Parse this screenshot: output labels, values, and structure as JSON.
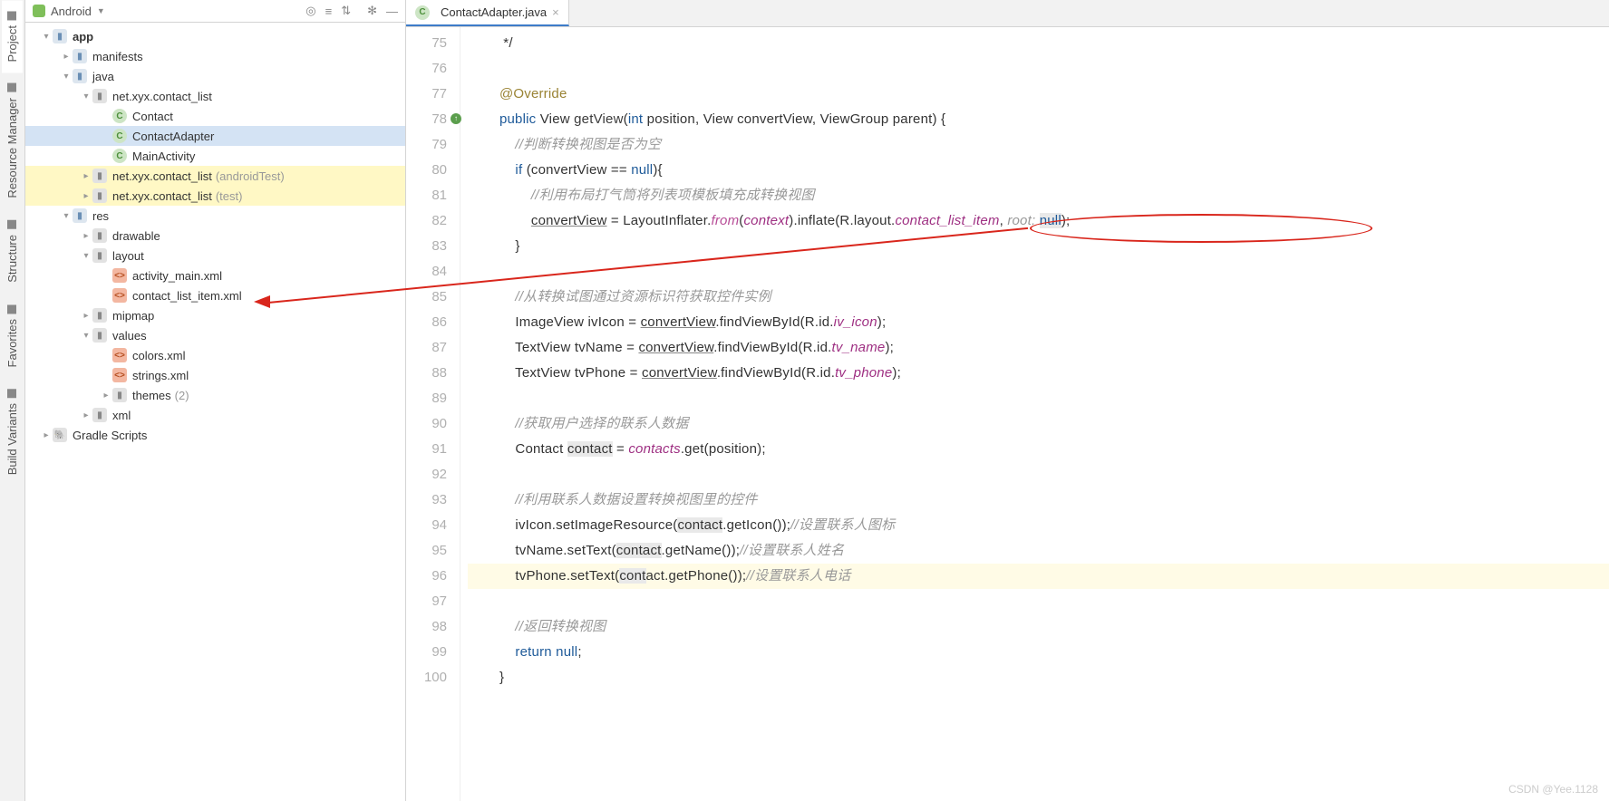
{
  "tool_tabs": [
    "Project",
    "Resource Manager",
    "Structure",
    "Favorites",
    "Build Variants"
  ],
  "panel": {
    "selector": "Android"
  },
  "tree": [
    {
      "d": 0,
      "a": "▾",
      "ic": "dir",
      "t": "app",
      "bold": true
    },
    {
      "d": 1,
      "a": "▸",
      "ic": "dir",
      "t": "manifests"
    },
    {
      "d": 1,
      "a": "▾",
      "ic": "dir",
      "t": "java"
    },
    {
      "d": 2,
      "a": "▾",
      "ic": "pkg",
      "t": "net.xyx.contact_list"
    },
    {
      "d": 3,
      "a": " ",
      "ic": "cls",
      "t": "Contact"
    },
    {
      "d": 3,
      "a": " ",
      "ic": "cls",
      "t": "ContactAdapter",
      "sel": true
    },
    {
      "d": 3,
      "a": " ",
      "ic": "cls",
      "t": "MainActivity"
    },
    {
      "d": 2,
      "a": "▸",
      "ic": "pkg",
      "t": "net.xyx.contact_list",
      "dim": "(androidTest)",
      "hl": true
    },
    {
      "d": 2,
      "a": "▸",
      "ic": "pkg",
      "t": "net.xyx.contact_list",
      "dim": "(test)",
      "hl": true
    },
    {
      "d": 1,
      "a": "▾",
      "ic": "dir",
      "t": "res"
    },
    {
      "d": 2,
      "a": "▸",
      "ic": "pkg",
      "t": "drawable"
    },
    {
      "d": 2,
      "a": "▾",
      "ic": "pkg",
      "t": "layout"
    },
    {
      "d": 3,
      "a": " ",
      "ic": "xml",
      "t": "activity_main.xml"
    },
    {
      "d": 3,
      "a": " ",
      "ic": "xml",
      "t": "contact_list_item.xml"
    },
    {
      "d": 2,
      "a": "▸",
      "ic": "pkg",
      "t": "mipmap"
    },
    {
      "d": 2,
      "a": "▾",
      "ic": "pkg",
      "t": "values"
    },
    {
      "d": 3,
      "a": " ",
      "ic": "xml",
      "t": "colors.xml"
    },
    {
      "d": 3,
      "a": " ",
      "ic": "xml",
      "t": "strings.xml"
    },
    {
      "d": 3,
      "a": "▸",
      "ic": "pkg",
      "t": "themes",
      "dim": "(2)"
    },
    {
      "d": 2,
      "a": "▸",
      "ic": "pkg",
      "t": "xml"
    },
    {
      "d": 0,
      "a": "▸",
      "ic": "grd",
      "t": "Gradle Scripts"
    }
  ],
  "tab": {
    "name": "ContactAdapter.java"
  },
  "code": {
    "start": 75,
    "lines": [
      {
        "html": "         */"
      },
      {
        "html": ""
      },
      {
        "html": "        <span class='an'>@Override</span>"
      },
      {
        "html": "        <span class='kw'>public</span> View <span class='fn'>getView</span>(<span class='kw'>int</span> position, View convertView, ViewGroup parent) {",
        "marker": "override"
      },
      {
        "html": "            <span class='cm'>//判断转换视图是否为空</span>"
      },
      {
        "html": "            <span class='kw'>if</span> (convertView == <span class='kw'>null</span>){"
      },
      {
        "html": "                <span class='cm'>//利用布局打气筒将列表项模板填充成转换视图</span>"
      },
      {
        "html": "                <span class='un'>convertView</span> = LayoutInflater.<span class='ps'>from</span>(<span class='pv'>context</span>).inflate(R.layout.<span class='pv'>contact_list_item</span>, <span class='cm'>root:</span> <span class='wr'><span class='kw'>null</span></span>);"
      },
      {
        "html": "            }"
      },
      {
        "html": ""
      },
      {
        "html": "            <span class='cm'>//从转换试图通过资源标识符获取控件实例</span>"
      },
      {
        "html": "            ImageView ivIcon = <span class='un'>convertView</span>.findViewById(R.id.<span class='pv'>iv_icon</span>);"
      },
      {
        "html": "            TextView tvName = <span class='un'>convertView</span>.findViewById(R.id.<span class='pv'>tv_name</span>);"
      },
      {
        "html": "            TextView tvPhone = <span class='un'>convertView</span>.findViewById(R.id.<span class='pv'>tv_phone</span>);"
      },
      {
        "html": ""
      },
      {
        "html": "            <span class='cm'>//获取用户选择的联系人数据</span>"
      },
      {
        "html": "            Contact <span class='wr'>contact</span> = <span class='pv'>contacts</span>.get(position);"
      },
      {
        "html": ""
      },
      {
        "html": "            <span class='cm'>//利用联系人数据设置转换视图里的控件</span>"
      },
      {
        "html": "            ivIcon.setImageResource(<span class='wr'>contact</span>.getIcon());<span class='cm'>//设置联系人图标</span>"
      },
      {
        "html": "            tvName.setText(<span class='wr'>contact</span>.getName());<span class='cm'>//设置联系人姓名</span>"
      },
      {
        "html": "            tvPhone.setText(<span class='wr'>cont</span>act.getPhone());<span class='cm'>//设置联系人电话</span>",
        "cur": true
      },
      {
        "html": ""
      },
      {
        "html": "            <span class='cm'>//返回转换视图</span>"
      },
      {
        "html": "            <span class='kw'>return null</span>;"
      },
      {
        "html": "        }"
      }
    ]
  },
  "watermark": "CSDN @Yee.1128"
}
